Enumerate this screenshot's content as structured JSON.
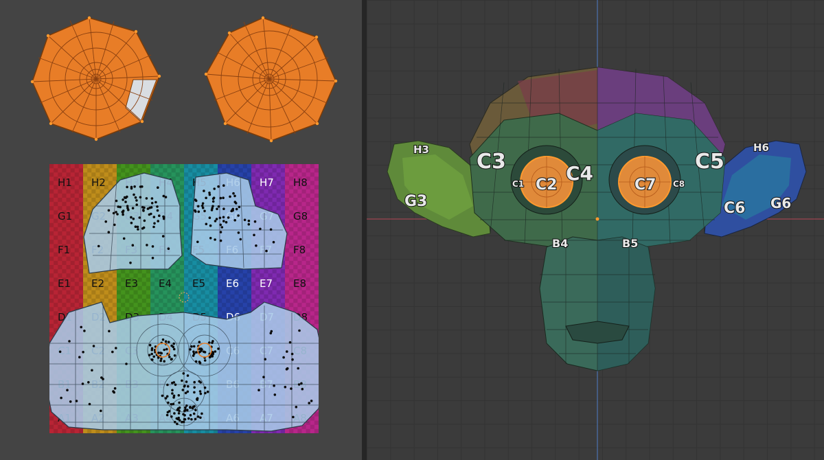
{
  "uv_editor": {
    "grid_rows": [
      {
        "row": "H",
        "cells": [
          "H1",
          "H2",
          "H3",
          "H4",
          "H5",
          "H6",
          "H7",
          "H8"
        ]
      },
      {
        "row": "G",
        "cells": [
          "G1",
          "G2",
          "G3",
          "G4",
          "G5",
          "G6",
          "G7",
          "G8"
        ]
      },
      {
        "row": "F",
        "cells": [
          "F1",
          "F2",
          "F3",
          "F4",
          "F5",
          "F6",
          "F7",
          "F8"
        ]
      },
      {
        "row": "E",
        "cells": [
          "E1",
          "E2",
          "E3",
          "E4",
          "E5",
          "E6",
          "E7",
          "E8"
        ]
      },
      {
        "row": "D",
        "cells": [
          "D1",
          "D2",
          "D3",
          "D4",
          "D5",
          "D6",
          "D7",
          "D8"
        ]
      },
      {
        "row": "C",
        "cells": [
          "C1",
          "C2",
          "C3",
          "C4",
          "C5",
          "C6",
          "C7",
          "C8"
        ]
      },
      {
        "row": "B",
        "cells": [
          "B1",
          "B2",
          "B3",
          "B4",
          "B5",
          "B6",
          "B7",
          "B8"
        ]
      },
      {
        "row": "A",
        "cells": [
          "A1",
          "A2",
          "A3",
          "A4",
          "A5",
          "A6",
          "A7",
          "A8"
        ]
      }
    ],
    "column_colors": [
      "#c8283a",
      "#d09a1e",
      "#4aa020",
      "#2aa064",
      "#1a9ab0",
      "#2a48b8",
      "#8a2ec0",
      "#c82a96"
    ],
    "selection_color": "#e87d27",
    "island_color": "#a8cbe8"
  },
  "viewport": {
    "face_labels": {
      "h3": "H3",
      "h6": "H6",
      "c2": "C2",
      "c7": "C7",
      "c1": "C1",
      "c8": "C8",
      "c4": "C4",
      "c3": "C3",
      "c5": "C5",
      "c6": "C6",
      "b4": "B4",
      "b5": "B5",
      "g3": "G3",
      "g6": "G6"
    },
    "axis_colors": {
      "x": "#b64656",
      "y": "#4f7ec7"
    }
  }
}
